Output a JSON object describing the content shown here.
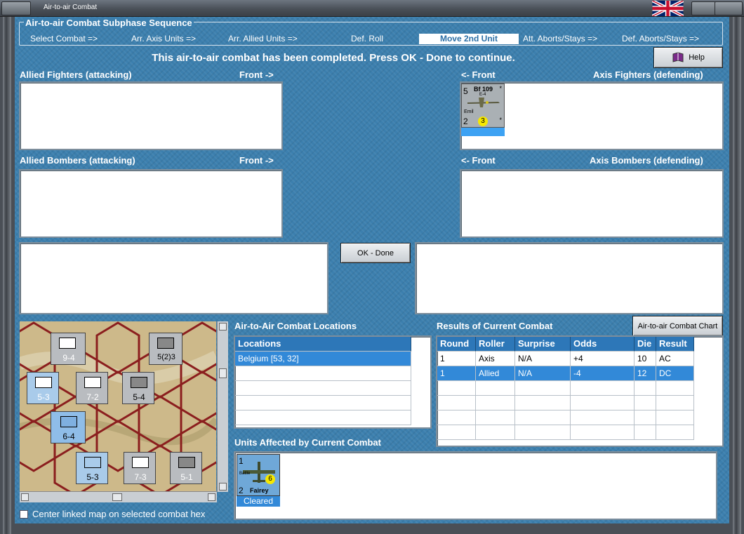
{
  "window": {
    "title": "Air-to-air Combat"
  },
  "sequence": {
    "legend": "Air-to-air Combat Subphase Sequence",
    "steps": [
      "Select Combat =>",
      "Arr. Axis Units =>",
      "Arr. Allied Units =>",
      "Def. Roll",
      "Move 2nd Unit",
      "Att. Aborts/Stays =>",
      "Def. Aborts/Stays =>"
    ],
    "active_index": 4
  },
  "message": "This air-to-air combat has been completed.  Press OK - Done to continue.",
  "help_label": "Help",
  "ok_done_label": "OK - Done",
  "chart_button_label": "Air-to-air Combat Chart",
  "allied_fighters": {
    "title": "Allied Fighters (attacking)",
    "front": "Front ->"
  },
  "axis_fighters": {
    "title": "Axis Fighters (defending)",
    "front": "<- Front"
  },
  "allied_bombers": {
    "title": "Allied Bombers (attacking)",
    "front": "Front ->"
  },
  "axis_bombers": {
    "title": "Axis Bombers (defending)",
    "front": "<- Front"
  },
  "axis_fighter_counter": {
    "name": "Bf 109",
    "variant": "E-4",
    "nickname": "Emil",
    "top_left": "5",
    "bottom_left": "2",
    "circle_value": "3",
    "star": "*"
  },
  "locations": {
    "section_title": "Air-to-Air Combat Locations",
    "header": "Locations",
    "rows": [
      "Belgium [53, 32]"
    ]
  },
  "results": {
    "section_title": "Results of Current Combat",
    "headers": [
      "Round",
      "Roller",
      "Surprise",
      "Odds",
      "Die",
      "Result"
    ],
    "rows": [
      [
        "1",
        "Axis",
        "N/A",
        "+4",
        "10",
        "AC"
      ],
      [
        "1",
        "Allied",
        "N/A",
        "-4",
        "12",
        "DC"
      ]
    ]
  },
  "affected": {
    "section_title": "Units Affected by Current Combat",
    "unit_name": "Fairey",
    "unit_type": "Battle",
    "top_left": "1",
    "bottom_left": "2",
    "circle_value": "6",
    "status": "Cleared"
  },
  "map_counters": [
    {
      "top": "9-4"
    },
    {
      "top": "5(2)3"
    },
    {
      "top": "7-2"
    },
    {
      "top": "5-4"
    },
    {
      "top": "5-3"
    },
    {
      "top": "6-4"
    },
    {
      "top": "5-3"
    },
    {
      "top": "7-3"
    },
    {
      "top": "5-1"
    }
  ],
  "center_checkbox_label": "Center linked map on selected combat hex",
  "colors": {
    "panel": "#3c7fae",
    "table_header": "#2d77b8",
    "selected_row": "#3289d8",
    "active_step_text": "#2c6fa6"
  }
}
